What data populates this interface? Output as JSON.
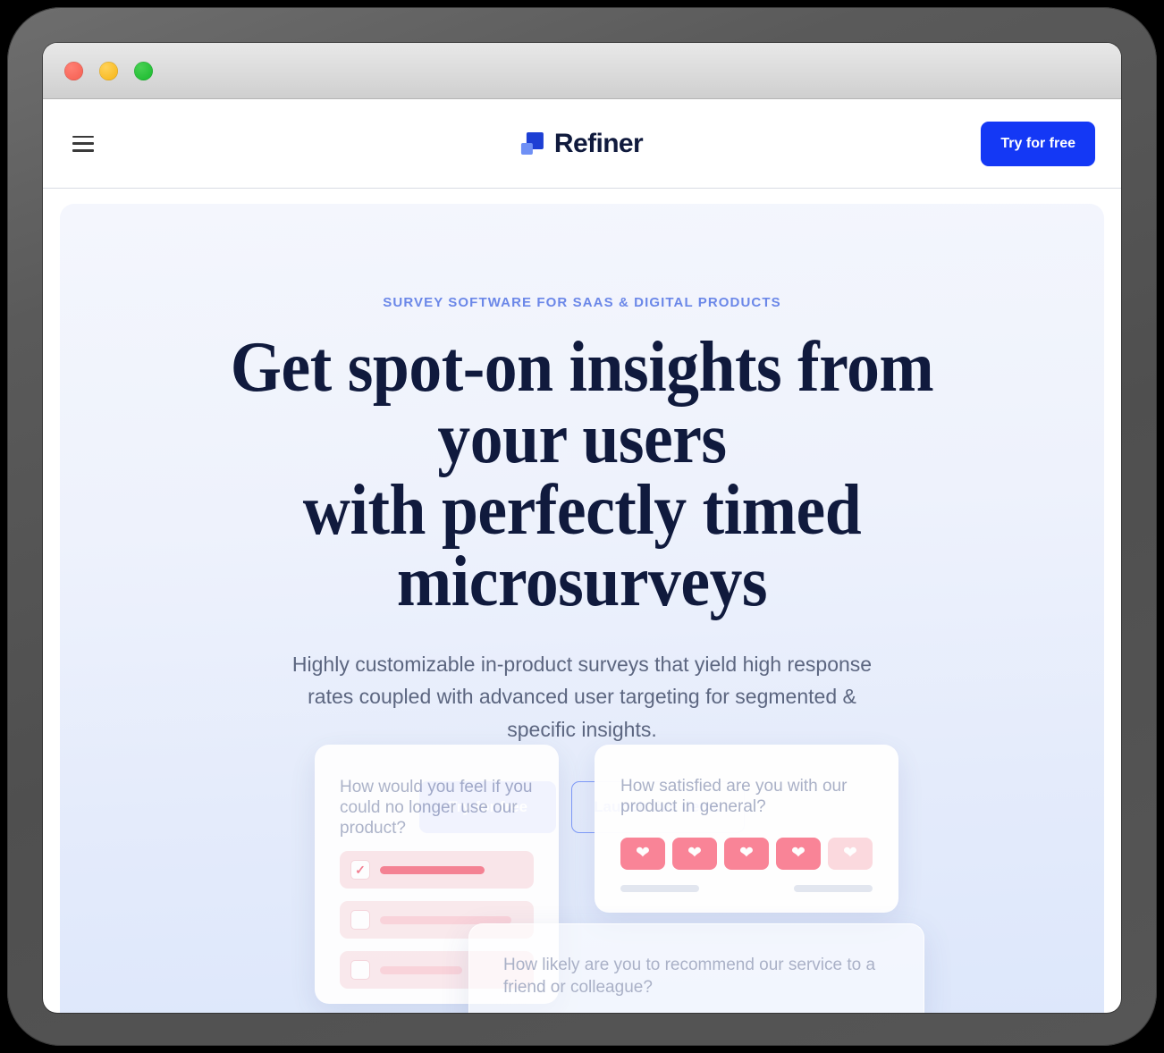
{
  "window": {
    "traffic_lights": [
      "close",
      "minimize",
      "maximize"
    ]
  },
  "header": {
    "menu_icon": "hamburger-icon",
    "brand": "Refiner",
    "cta_label": "Try for free"
  },
  "hero": {
    "eyebrow": "SURVEY SOFTWARE FOR SAAS & DIGITAL PRODUCTS",
    "title_line_1": "Get spot-on insights from your users",
    "title_line_2": "with perfectly timed microsurveys",
    "subtitle": "Highly customizable in-product surveys that yield high response rates coupled with advanced user targeting for segmented & specific insights.",
    "primary_cta": "Try for free",
    "secondary_cta": "Launch live demo"
  },
  "cards": {
    "card1": {
      "question": "How would you feel if you could no longer use our product?",
      "options": [
        {
          "selected": true,
          "state": "checked"
        },
        {
          "selected": false,
          "state": "unchecked"
        },
        {
          "selected": false,
          "state": "unchecked"
        }
      ]
    },
    "card2": {
      "question": "How satisfied are you with our product in general?",
      "hearts": [
        {
          "filled": true
        },
        {
          "filled": true
        },
        {
          "filled": true
        },
        {
          "filled": true
        },
        {
          "filled": false
        }
      ]
    },
    "card3": {
      "question": "How likely are you to recommend our service to a friend or colleague?"
    }
  },
  "colors": {
    "brand_blue": "#1438f5",
    "logo_dark": "#1d3fd4",
    "logo_light": "#6f90f5",
    "navy": "#101a3d",
    "eyebrow_blue": "#6b87e8",
    "body_gray": "#5c6680",
    "pink": "#fa8194",
    "pink_pale": "#fcd9de",
    "hero_bg_top": "#f4f6fd",
    "hero_bg_bottom": "#dde7fb"
  }
}
